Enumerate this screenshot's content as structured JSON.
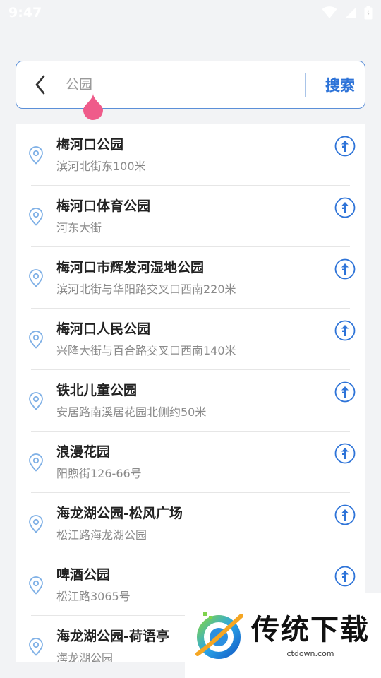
{
  "status_bar": {
    "time": "9:47"
  },
  "search": {
    "placeholder": "公园",
    "button_label": "搜索"
  },
  "results": [
    {
      "name": "梅河口公园",
      "address": "滨河北街东100米"
    },
    {
      "name": "梅河口体育公园",
      "address": "河东大街"
    },
    {
      "name": "梅河口市辉发河湿地公园",
      "address": "滨河北街与华阳路交叉口西南220米"
    },
    {
      "name": "梅河口人民公园",
      "address": "兴隆大街与百合路交叉口西南140米"
    },
    {
      "name": "铁北儿童公园",
      "address": "安居路南溪居花园北侧约50米"
    },
    {
      "name": "浪漫花园",
      "address": "阳煦街126-66号"
    },
    {
      "name": "海龙湖公园-松风广场",
      "address": "松江路海龙湖公园"
    },
    {
      "name": "啤酒公园",
      "address": "松江路3065号"
    },
    {
      "name": "海龙湖公园-荷语亭",
      "address": "海龙湖公园"
    }
  ],
  "watermark": {
    "title": "传统下载",
    "url": "ctdown.com"
  },
  "colors": {
    "accent": "#2d73d8",
    "pin": "#7fb0e6",
    "cursor": "#ef5b8a"
  }
}
